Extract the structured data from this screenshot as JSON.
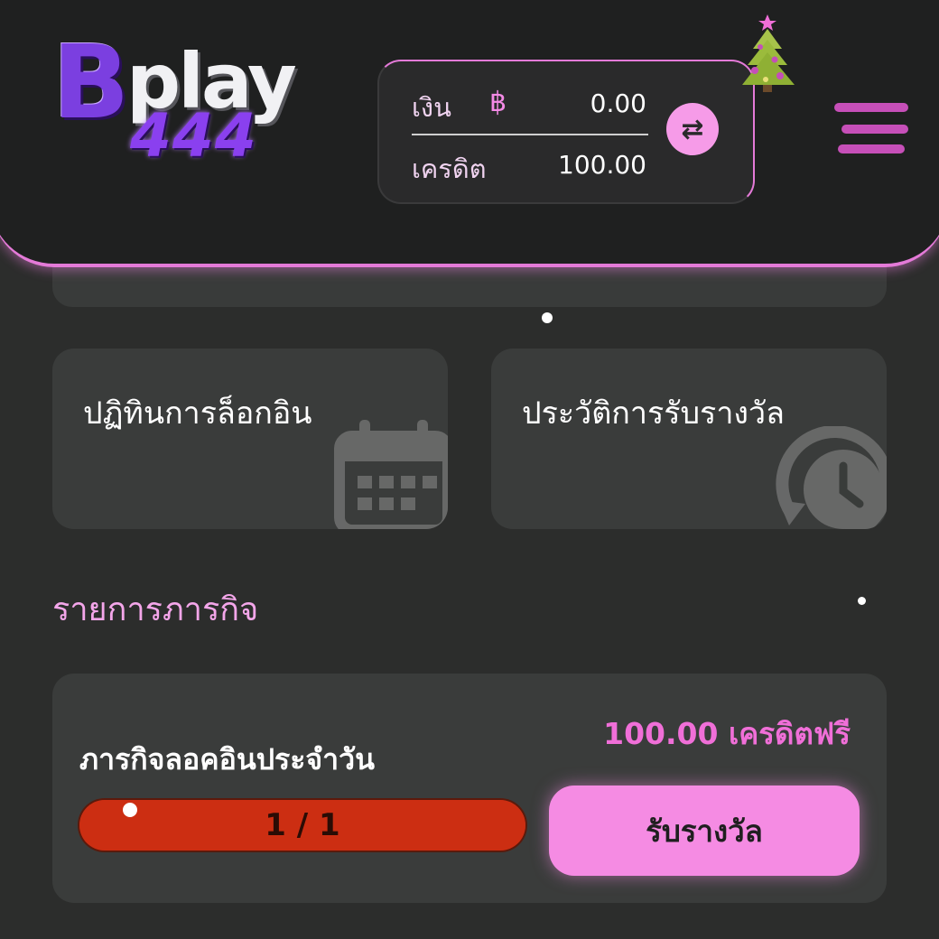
{
  "header": {
    "logo": {
      "b": "B",
      "play": "play",
      "number": "444"
    },
    "wallet": {
      "money_label": "เงิน",
      "currency_symbol": "฿",
      "money_value": "0.00",
      "credit_label": "เครดิต",
      "credit_value": "100.00",
      "swap_icon": "⇄"
    },
    "decoration_icon": "christmas-tree-icon",
    "menu_icon": "hamburger-menu-icon"
  },
  "cards": [
    {
      "title": "ปฏิทินการล็อกอิน",
      "icon": "calendar-icon"
    },
    {
      "title": "ประวัติการรับรางวัล",
      "icon": "history-clock-icon"
    }
  ],
  "missions": {
    "section_title": "รายการภารกิจ",
    "items": [
      {
        "name": "ภารกิจลอคอินประจำวัน",
        "reward": "100.00 เครดิตฟรี",
        "progress_text": "1 / 1",
        "progress_fraction": 1.0,
        "claim_label": "รับรางวัล"
      }
    ]
  },
  "colors": {
    "background": "#2c2d2c",
    "accent_pink": "#f58be3",
    "progress_red": "#cc2e12",
    "logo_purple": "#7b3fe0"
  }
}
